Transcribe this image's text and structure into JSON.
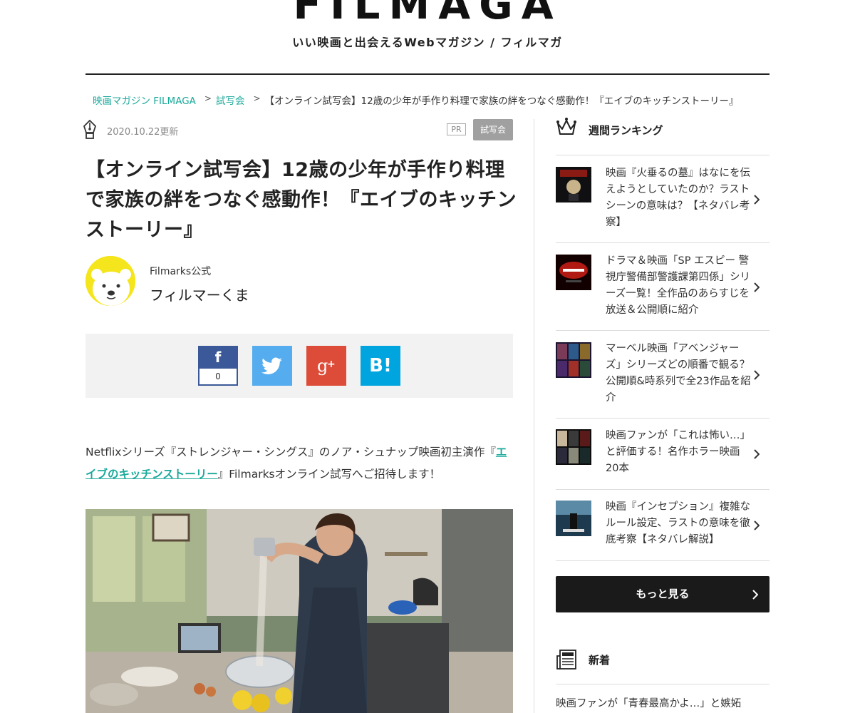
{
  "header": {
    "logo": "FILMAGA",
    "tagline": "いい映画と出会えるWebマガジン / フィルマガ"
  },
  "breadcrumb": {
    "home": "映画マガジン FILMAGA",
    "category": "試写会",
    "current": "【オンライン試写会】12歳の少年が手作り料理で家族の絆をつなぐ感動作！『エイブのキッチンストーリー』",
    "separator": ">"
  },
  "meta": {
    "date": "2020.10.22更新",
    "pr_label": "PR",
    "category_badge": "試写会"
  },
  "article": {
    "title": "【オンライン試写会】12歳の少年が手作り料理で家族の絆をつなぐ感動作！『エイブのキッチンストーリー』",
    "author_org": "Filmarks公式",
    "author_name": "フィルマーくま",
    "body_prefix": "Netflixシリーズ『ストレンジャー・シングス』のノア・シュナップ映画初主演作『",
    "body_link": "エイブのキッチンストーリー",
    "body_suffix": "』Filmarksオンライン試写へご招待します！"
  },
  "share": {
    "facebook_glyph": "f",
    "facebook_count": "0",
    "hatena_label": "B!"
  },
  "sidebar": {
    "ranking_heading": "週間ランキング",
    "ranking": [
      {
        "title": "映画『火垂るの墓』はなにを伝えようとしていたのか？ラストシーンの意味は？【ネタバレ考察】"
      },
      {
        "title": "ドラマ＆映画「SP エスピー 警視庁警備部警護課第四係」シリーズ一覧！全作品のあらすじを放送＆公開順に紹介"
      },
      {
        "title": "マーベル映画「アベンジャーズ」シリーズどの順番で観る？公開順&時系列で全23作品を紹介"
      },
      {
        "title": "映画ファンが「これは怖い…」と評価する！名作ホラー映画20本"
      },
      {
        "title": "映画『インセプション』複雑なルール設定、ラストの意味を徹底考察【ネタバレ解説】"
      }
    ],
    "more_label": "もっと見る",
    "news_heading": "新着",
    "news_first": "映画ファンが「青春最高かよ…」と嫉妬"
  },
  "colors": {
    "accent": "#1aa99b",
    "facebook": "#3b5998",
    "twitter": "#55acee",
    "googleplus": "#dd4b39",
    "hatena": "#00a4de",
    "more_button": "#1a1a1a"
  }
}
